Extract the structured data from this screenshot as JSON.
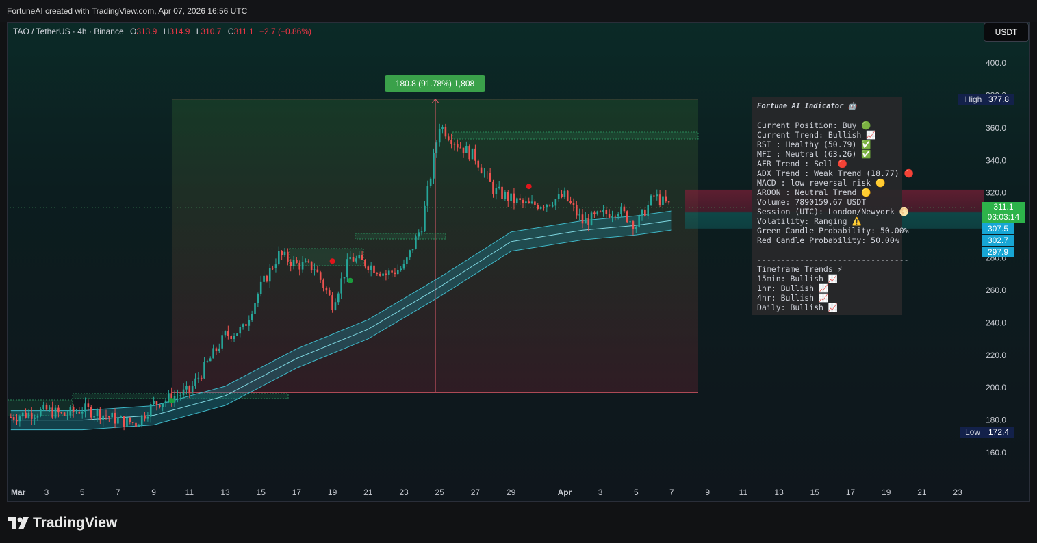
{
  "header": {
    "credit": "FortuneAI created with TradingView.com, Apr 07, 2026 16:56 UTC"
  },
  "legend": {
    "symbol": "TAO / TetherUS · 4h · Binance",
    "o_label": "O",
    "o_value": "313.9",
    "h_label": "H",
    "h_value": "314.9",
    "l_label": "L",
    "l_value": "310.7",
    "c_label": "C",
    "c_value": "311.1",
    "change": "−2.7 (−0.86%)"
  },
  "currency_button": "USDT",
  "measure_label": "180.8 (91.78%) 1,808",
  "price_axis": {
    "ticks": [
      "400.0",
      "380.0",
      "360.0",
      "340.0",
      "320.0",
      "300.0",
      "280.0",
      "260.0",
      "240.0",
      "220.0",
      "200.0",
      "180.0",
      "160.0"
    ],
    "high_label": "High",
    "high_value": "377.8",
    "low_label": "Low",
    "low_value": "172.4",
    "last_price": "311.1",
    "countdown": "03:03:14",
    "band_upper": "307.5",
    "band_mid": "302.7",
    "band_lower": "297.9"
  },
  "time_axis": {
    "labels": [
      "Mar",
      "3",
      "5",
      "7",
      "9",
      "11",
      "13",
      "15",
      "17",
      "19",
      "21",
      "23",
      "25",
      "27",
      "29",
      "Apr",
      "3",
      "5",
      "7",
      "9",
      "11",
      "13",
      "15",
      "17",
      "19",
      "21",
      "23"
    ]
  },
  "indicator": {
    "title": "Fortune AI Indicator 🤖",
    "rows": [
      "Current Position: Buy 🟢",
      "Current Trend: Bullish 📈",
      "RSI : Healthy (50.79) ✅",
      "MFI : Neutral (63.26) ✅",
      "AFR Trend : Sell 🔴",
      "ADX Trend : Weak Trend (18.77) 🔴",
      "MACD : low reversal risk 🟡",
      "AROON : Neutral Trend 🟡",
      "Volume: 7890159.67 USDT",
      "Session (UTC): London/Newyork 🌕",
      "Volatility: Ranging ⚠️",
      "Green Candle Probability: 50.00%",
      "Red Candle Probability: 50.00%"
    ],
    "divider": "--------------------------------",
    "tf_title": "Timeframe Trends ⚡",
    "tf_rows": [
      "15min: Bullish 📈",
      "1hr: Bullish 📈",
      "4hr: Bullish 📈",
      "Daily: Bullish 📈"
    ]
  },
  "footer": {
    "brand": "TradingView"
  },
  "chart_data": {
    "type": "candlestick",
    "title": "",
    "symbol": "TAO / TetherUS",
    "interval": "4h",
    "exchange": "Binance",
    "ylim": [
      150,
      410
    ],
    "yticks": [
      400,
      380,
      360,
      340,
      320,
      300,
      280,
      260,
      240,
      220,
      200,
      180,
      160
    ],
    "high": 377.8,
    "low": 172.4,
    "last": 311.1,
    "series": [
      {
        "name": "close_path",
        "points": [
          [
            "Mar 1",
            182
          ],
          [
            "Mar 2",
            184
          ],
          [
            "Mar 3",
            186
          ],
          [
            "Mar 4",
            183
          ],
          [
            "Mar 5",
            187
          ],
          [
            "Mar 6",
            184
          ],
          [
            "Mar 7",
            180
          ],
          [
            "Mar 8",
            178
          ],
          [
            "Mar 9",
            190
          ],
          [
            "Mar 10",
            194
          ],
          [
            "Mar 11",
            198
          ],
          [
            "Mar 12",
            215
          ],
          [
            "Mar 13",
            232
          ],
          [
            "Mar 14",
            236
          ],
          [
            "Mar 15",
            262
          ],
          [
            "Mar 16",
            282
          ],
          [
            "Mar 17",
            276
          ],
          [
            "Mar 18",
            274
          ],
          [
            "Mar 19",
            252
          ],
          [
            "Mar 20",
            280
          ],
          [
            "Mar 21",
            276
          ],
          [
            "Mar 22",
            270
          ],
          [
            "Mar 23",
            274
          ],
          [
            "Mar 24",
            300
          ],
          [
            "Mar 25",
            362
          ],
          [
            "Mar 26",
            350
          ],
          [
            "Mar 27",
            342
          ],
          [
            "Mar 28",
            322
          ],
          [
            "Mar 29",
            316
          ],
          [
            "Mar 30",
            312
          ],
          [
            "Mar 31",
            314
          ],
          [
            "Apr 1",
            318
          ],
          [
            "Apr 2",
            302
          ],
          [
            "Apr 3",
            306
          ],
          [
            "Apr 4",
            310
          ],
          [
            "Apr 5",
            300
          ],
          [
            "Apr 6",
            318
          ],
          [
            "Apr 7",
            311
          ]
        ]
      },
      {
        "name": "ema_band_mid",
        "points": [
          [
            "Mar 1",
            180
          ],
          [
            "Mar 5",
            180
          ],
          [
            "Mar 9",
            183
          ],
          [
            "Mar 13",
            195
          ],
          [
            "Mar 17",
            218
          ],
          [
            "Mar 21",
            236
          ],
          [
            "Mar 25",
            262
          ],
          [
            "Mar 29",
            290
          ],
          [
            "Apr 2",
            297
          ],
          [
            "Apr 5",
            300
          ],
          [
            "Apr 7",
            303
          ]
        ]
      }
    ],
    "markers": [
      {
        "date": "Mar 10",
        "price": 192,
        "color": "#1b9c3c"
      },
      {
        "date": "Mar 19",
        "price": 278,
        "color": "#e0161c"
      },
      {
        "date": "Mar 20",
        "price": 266,
        "color": "#1b9c3c"
      },
      {
        "date": "Mar 30",
        "price": 324,
        "color": "#e0161c"
      }
    ],
    "measure": {
      "from": 197.0,
      "to": 377.8,
      "change": 180.8,
      "percent": 91.78,
      "bars": 1808
    }
  }
}
